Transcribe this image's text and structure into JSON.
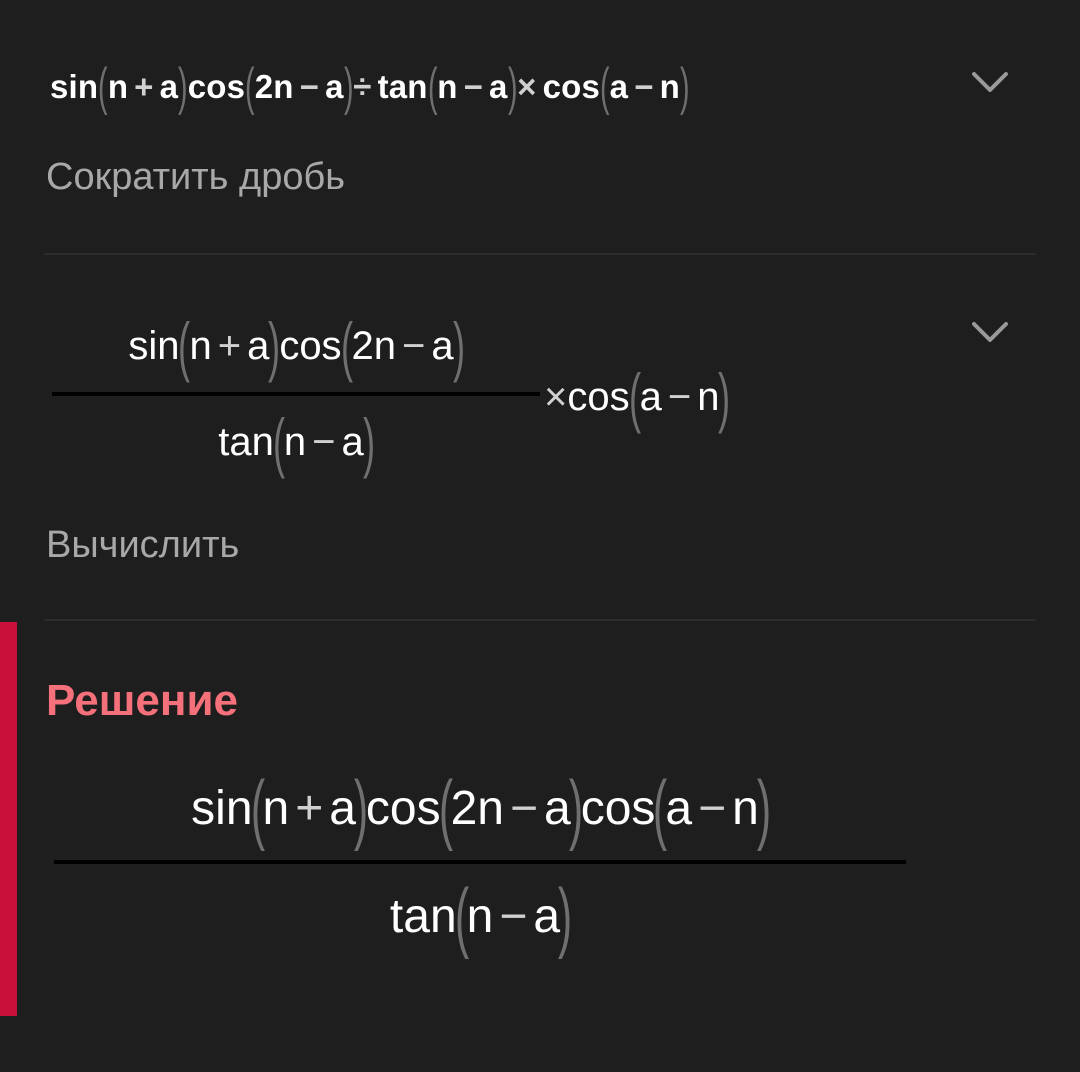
{
  "items": [
    {
      "expression": {
        "sin": "sin",
        "n": "n",
        "plus": "+",
        "a": "a",
        "cos": "cos",
        "two_n": "2n",
        "minus": "−",
        "div": "÷",
        "tan": "tan",
        "times": "×"
      },
      "caption": "Сократить дробь"
    },
    {
      "expression": {
        "sin": "sin",
        "n": "n",
        "plus": "+",
        "a": "a",
        "cos": "cos",
        "two_n": "2n",
        "minus": "−",
        "tan": "tan",
        "times": "×"
      },
      "caption": "Вычислить"
    }
  ],
  "solution": {
    "title": "Решение",
    "expression": {
      "sin": "sin",
      "n": "n",
      "plus": "+",
      "a": "a",
      "cos": "cos",
      "two_n": "2n",
      "minus": "−",
      "tan": "tan"
    }
  },
  "colors": {
    "background": "#1e1e1e",
    "accent": "#c8103a",
    "title": "#f4707a",
    "caption": "#a8a8a8"
  },
  "icons": {
    "expand": "chevron-down-icon"
  }
}
